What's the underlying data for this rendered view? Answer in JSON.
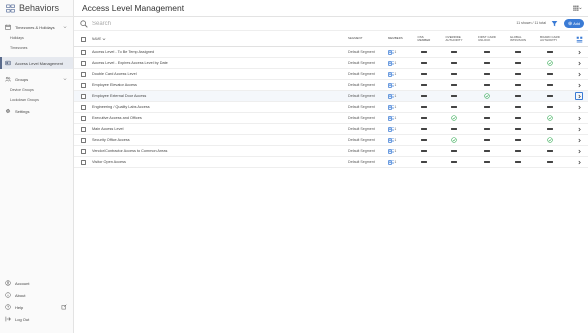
{
  "sidebar": {
    "brand": "Behaviors",
    "nav": [
      {
        "label": "Timezones & Holidays",
        "icon": "calendar-icon",
        "caret": true,
        "active": false
      },
      {
        "label": "Holidays",
        "sub": true
      },
      {
        "label": "Timezones",
        "sub": true
      },
      {
        "label": "Access Level Management",
        "icon": "access-level-icon",
        "caret": false,
        "active": true
      },
      {
        "label": "Groups",
        "icon": "groups-icon",
        "caret": true,
        "active": false
      },
      {
        "label": "Device Groups",
        "sub": true
      },
      {
        "label": "Lockdown Groups",
        "sub": true
      },
      {
        "label": "Settings",
        "icon": "gear-icon",
        "caret": false,
        "active": false
      }
    ],
    "bottom": [
      {
        "label": "Account",
        "icon": "account-icon"
      },
      {
        "label": "About",
        "icon": "info-icon"
      },
      {
        "label": "Help",
        "icon": "help-icon"
      },
      {
        "label": "Log Out",
        "icon": "logout-icon"
      }
    ]
  },
  "header": {
    "title": "Access Level Management"
  },
  "search": {
    "placeholder": "Search"
  },
  "toolbar": {
    "rows_count": "11 shown / 11 total",
    "add_label": "Add"
  },
  "table": {
    "headers": {
      "name": "NAME",
      "segment": "SEGMENT",
      "members": "MEMBERS",
      "col1": [
        "OSS",
        "MEMBER"
      ],
      "col2": [
        "OVERRIDE",
        "AUTHORITY"
      ],
      "col3": [
        "FIRST CARD",
        "UNLOCK"
      ],
      "col4": [
        "GLOBAL",
        "INTRUSION"
      ],
      "col5": [
        "BOARD CARD",
        "AUTHORITY"
      ]
    },
    "rows": [
      {
        "name": "Access Level - To Be Temp Assigned",
        "segment": "Default Segment",
        "members": "1",
        "flags": [
          "dash",
          "dash",
          "dash",
          "dash",
          "dash"
        ],
        "highlight": false
      },
      {
        "name": "Access Level - Expires Access Level by Date",
        "segment": "Default Segment",
        "members": "1",
        "flags": [
          "dash",
          "dash",
          "dash",
          "dash",
          "check"
        ],
        "highlight": false
      },
      {
        "name": "Double Card Access Level",
        "segment": "Default Segment",
        "members": "1",
        "flags": [
          "dash",
          "dash",
          "dash",
          "dash",
          "dash"
        ],
        "highlight": false
      },
      {
        "name": "Employee Elevator Access",
        "segment": "Default Segment",
        "members": "1",
        "flags": [
          "dash",
          "dash",
          "dash",
          "dash",
          "dash"
        ],
        "highlight": false
      },
      {
        "name": "Employee External Door Access",
        "segment": "Default Segment",
        "members": "1",
        "flags": [
          "dash",
          "dash",
          "check",
          "dash",
          "dash"
        ],
        "highlight": true
      },
      {
        "name": "Engineering / Quality Labs Access",
        "segment": "Default Segment",
        "members": "1",
        "flags": [
          "dash",
          "dash",
          "dash",
          "dash",
          "dash"
        ],
        "highlight": false
      },
      {
        "name": "Executive Access and Offices",
        "segment": "Default Segment",
        "members": "1",
        "flags": [
          "dash",
          "check",
          "dash",
          "dash",
          "check"
        ],
        "highlight": false
      },
      {
        "name": "Main Access Level",
        "segment": "Default Segment",
        "members": "1",
        "flags": [
          "dash",
          "dash",
          "dash",
          "dash",
          "dash"
        ],
        "highlight": false
      },
      {
        "name": "Security Office Access",
        "segment": "Default Segment",
        "members": "1",
        "flags": [
          "dash",
          "check",
          "dash",
          "dash",
          "check"
        ],
        "highlight": false
      },
      {
        "name": "Vendor/Contractor Access to Common Areas",
        "segment": "Default Segment",
        "members": "1",
        "flags": [
          "dash",
          "dash",
          "dash",
          "dash",
          "dash"
        ],
        "highlight": false
      },
      {
        "name": "Visitor Open Access",
        "segment": "Default Segment",
        "members": "1",
        "flags": [
          "dash",
          "dash",
          "dash",
          "dash",
          "dash"
        ],
        "highlight": false
      }
    ]
  },
  "colors": {
    "accent": "#3a7bd5",
    "check": "#2fa84f"
  }
}
